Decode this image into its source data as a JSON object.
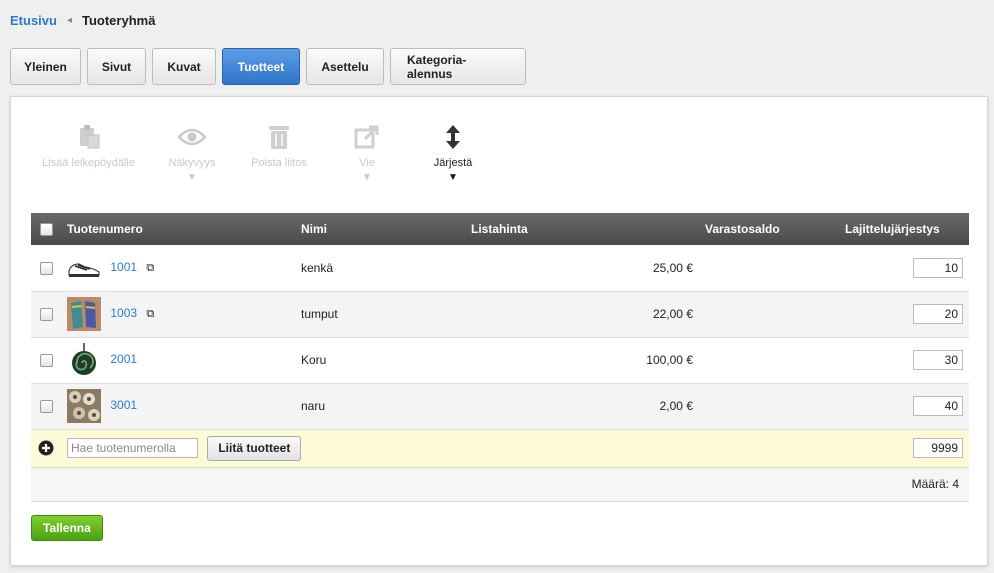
{
  "breadcrumb": {
    "home": "Etusivu",
    "separator": "◂",
    "current": "Tuoteryhmä"
  },
  "tabs": [
    {
      "label": "Yleinen",
      "active": false
    },
    {
      "label": "Sivut",
      "active": false
    },
    {
      "label": "Kuvat",
      "active": false
    },
    {
      "label": "Tuotteet",
      "active": true
    },
    {
      "label": "Asettelu",
      "active": false
    },
    {
      "label": "Kategoria-alennus",
      "active": false
    }
  ],
  "toolbar": {
    "clipboard": {
      "label": "Lisää leikepöydälle",
      "icon": "clipboard-icon",
      "enabled": false
    },
    "visibility": {
      "label": "Näkyvyys",
      "icon": "eye-icon",
      "enabled": false
    },
    "delete_link": {
      "label": "Poista liitos",
      "icon": "trash-icon",
      "enabled": false
    },
    "export": {
      "label": "Vie",
      "icon": "export-icon",
      "enabled": false
    },
    "sort": {
      "label": "Järjestä",
      "icon": "sort-arrows-icon",
      "enabled": true
    }
  },
  "table": {
    "headers": {
      "product_number": "Tuotenumero",
      "name": "Nimi",
      "list_price": "Listahinta",
      "stock": "Varastosaldo",
      "sort_order": "Lajittelujärjestys"
    },
    "rows": [
      {
        "product_number": "1001",
        "name": "kenkä",
        "list_price": "25,00 €",
        "stock": "",
        "sort_order": "10",
        "image": "shoe-thumbnail",
        "has_popup": true
      },
      {
        "product_number": "1003",
        "name": "tumput",
        "list_price": "22,00 €",
        "stock": "",
        "sort_order": "20",
        "image": "gloves-thumbnail",
        "has_popup": true
      },
      {
        "product_number": "2001",
        "name": "Koru",
        "list_price": "100,00 €",
        "stock": "",
        "sort_order": "30",
        "image": "pendant-thumbnail",
        "has_popup": false
      },
      {
        "product_number": "3001",
        "name": "naru",
        "list_price": "2,00 €",
        "stock": "",
        "sort_order": "40",
        "image": "beads-thumbnail",
        "has_popup": false
      }
    ],
    "add_row": {
      "search_placeholder": "Hae tuotenumerolla",
      "attach_button": "Liitä tuotteet",
      "default_order": "9999"
    },
    "footer": {
      "count_text": "Määrä: 4"
    }
  },
  "save_button": "Tallenna",
  "colors": {
    "accent": "#2f74c8",
    "link": "#2a7bd0",
    "save": "#4aa112",
    "add_row_bg": "#fdfbd7"
  }
}
